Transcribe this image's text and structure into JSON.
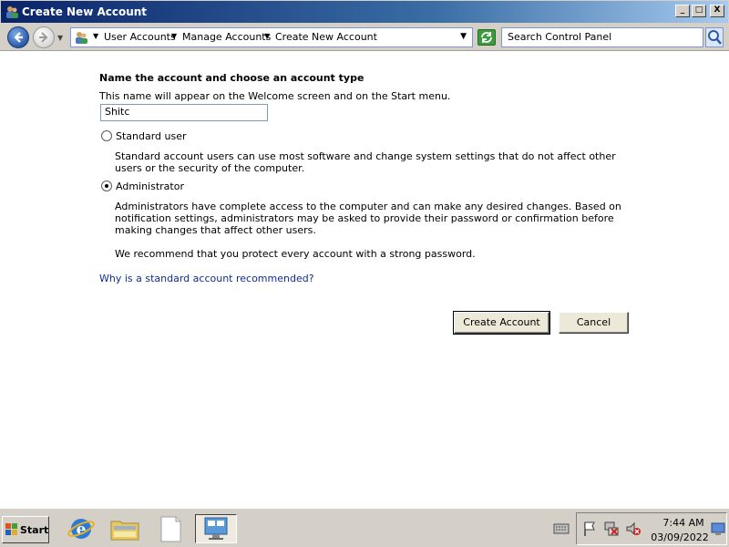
{
  "window": {
    "title": "Create New Account",
    "buttons": {
      "minimize": "_",
      "maximize": "□",
      "close": "X"
    }
  },
  "address_bar": {
    "breadcrumbs": [
      "User Accounts",
      "Manage Accounts",
      "Create New Account"
    ],
    "search_placeholder": "Search Control Panel"
  },
  "form": {
    "heading": "Name the account and choose an account type",
    "subtext": "This name will appear on the Welcome screen and on the Start menu.",
    "name_value": "Shitc",
    "options": [
      {
        "label": "Standard user",
        "checked": false,
        "description": "Standard account users can use most software and change system settings that do not affect other users or the security of the computer."
      },
      {
        "label": "Administrator",
        "checked": true,
        "description": "Administrators have complete access to the computer and can make any desired changes. Based on notification settings, administrators may be asked to provide their password or confirmation before making changes that affect other users."
      }
    ],
    "recommendation": "We recommend that you protect every account with a strong password.",
    "help_link": "Why is a standard account recommended?",
    "create_button": "Create Account",
    "cancel_button": "Cancel"
  },
  "taskbar": {
    "start_label": "Start",
    "icons": [
      "internet-explorer-icon",
      "file-explorer-icon",
      "blank-document-icon",
      "control-panel-icon"
    ],
    "active_icon": "control-panel-icon",
    "tray_icons": [
      "keyboard-icon",
      "flag-icon",
      "network-icon",
      "volume-muted-icon"
    ],
    "time": "7:44 AM",
    "date": "03/09/2022"
  },
  "colors": {
    "title_bar": "#0a246a",
    "link": "#0b2e94",
    "chrome": "#d4d0c8"
  }
}
